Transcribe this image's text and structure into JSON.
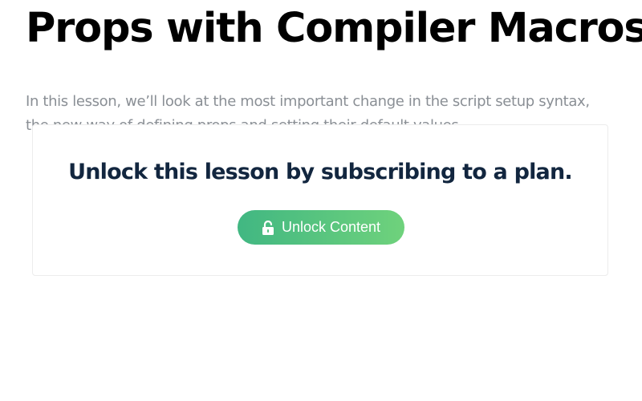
{
  "lesson": {
    "title": "Props with Compiler Macros",
    "intro_line1": "In this lesson, we’ll look at the most important change in the script setup syntax,",
    "intro_line2": "the new way of defining props and setting their default values."
  },
  "paywall": {
    "heading": "Unlock this lesson by subscribing to a plan.",
    "button_label": "Unlock Content",
    "button_icon": "unlock-icon"
  },
  "colors": {
    "title": "#000000",
    "body_text": "#8a8f95",
    "heading": "#12263f",
    "button_gradient_start": "#41b782",
    "button_gradient_end": "#6fd27c"
  }
}
